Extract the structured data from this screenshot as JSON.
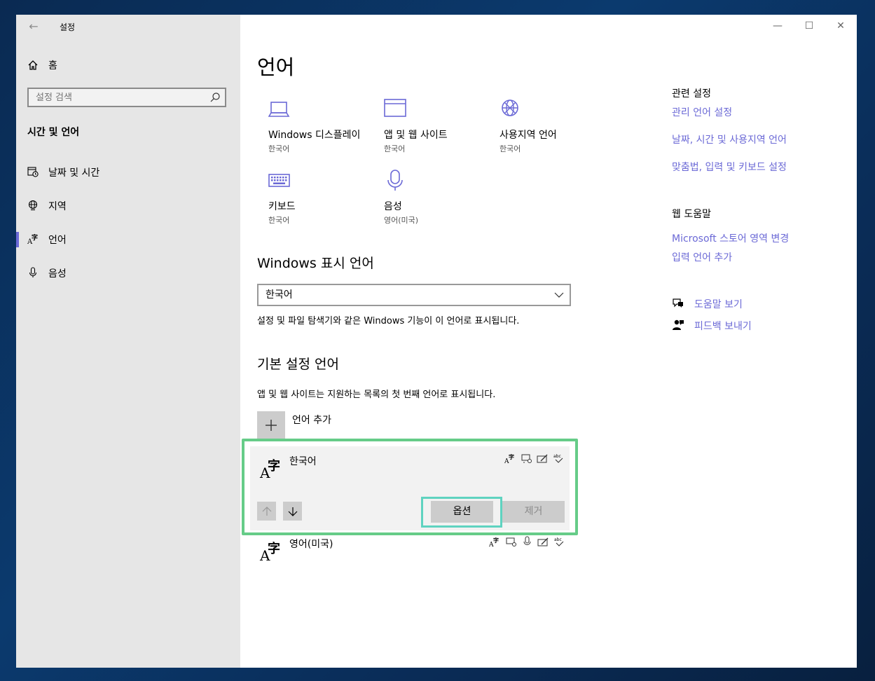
{
  "app": {
    "title": "설정",
    "back_glyph": "←"
  },
  "window_controls": {
    "minimize": "—",
    "maximize": "☐",
    "close": "✕"
  },
  "sidebar": {
    "home_label": "홈",
    "search_placeholder": "설정 검색",
    "section_title": "시간 및 언어",
    "items": [
      {
        "label": "날짜 및 시간",
        "icon": "calendar-clock-icon"
      },
      {
        "label": "지역",
        "icon": "globe-icon"
      },
      {
        "label": "언어",
        "icon": "language-icon",
        "selected": true
      },
      {
        "label": "음성",
        "icon": "microphone-icon"
      }
    ]
  },
  "main": {
    "title": "언어",
    "tiles": [
      {
        "name": "Windows 디스플레이",
        "sub": "한국어",
        "icon": "laptop-icon"
      },
      {
        "name": "앱 및 웹 사이트",
        "sub": "한국어",
        "icon": "window-icon"
      },
      {
        "name": "사용지역 언어",
        "sub": "한국어",
        "icon": "region-globe-icon"
      },
      {
        "name": "키보드",
        "sub": "한국어",
        "icon": "keyboard-icon"
      },
      {
        "name": "음성",
        "sub": "영어(미국)",
        "icon": "microphone-icon"
      }
    ],
    "display_language": {
      "heading": "Windows 표시 언어",
      "selected": "한국어",
      "description": "설정 및 파일 탐색기와 같은 Windows 기능이 이 언어로 표시됩니다."
    },
    "preferred": {
      "heading": "기본 설정 언어",
      "description": "앱 및 웹 사이트는 지원하는 목록의 첫 번째 언어로 표시됩니다.",
      "add_label": "언어 추가",
      "languages": [
        {
          "name": "한국어"
        },
        {
          "name": "영어(미국)"
        }
      ],
      "options_label": "옵션",
      "remove_label": "제거"
    }
  },
  "related": {
    "heading": "관련 설정",
    "links": [
      "관리 언어 설정",
      "날짜, 시간 및 사용지역 언어",
      "맞춤법, 입력 및 키보드 설정"
    ],
    "web_help_heading": "웹 도움말",
    "web_links": [
      "Microsoft 스토어 영역 변경",
      "입력 언어 추가"
    ],
    "help_label": "도움말 보기",
    "feedback_label": "피드백 보내기"
  },
  "colors": {
    "accent": "#6b69d6",
    "highlight_green": "#66cc88",
    "highlight_teal": "#5fd3c0"
  }
}
